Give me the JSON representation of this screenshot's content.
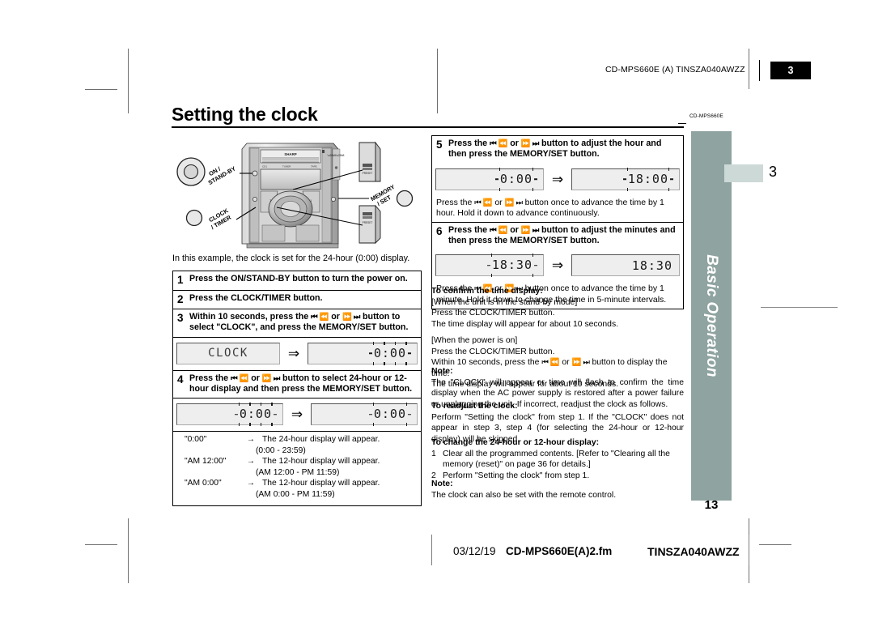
{
  "header": {
    "code": "CD-MPS660E (A) TINSZA040AWZZ",
    "page_badge": "3"
  },
  "title": "Setting the clock",
  "model_tag": "CD-MPS660E",
  "sidebar": {
    "label": "Basic Operation",
    "page_number": "13",
    "chapter_number": "3"
  },
  "footer": {
    "date": "03/12/19",
    "filename": "CD-MPS660E(A)2.fm",
    "code": "TINSZA040AWZZ"
  },
  "illustration": {
    "labels": {
      "on_standby": "ON /\nSTAND-BY",
      "clock_timer": "CLOCK\n/ TIMER",
      "memory_set": "MEMORY\n/ SET"
    },
    "brand": "SHARP"
  },
  "left": {
    "lead": "In this example, the clock is set for the 24-hour (0:00) display.",
    "steps": [
      {
        "num": "1",
        "text": "Press the ON/STAND-BY button to turn the power on."
      },
      {
        "num": "2",
        "text": "Press the CLOCK/TIMER button."
      },
      {
        "num": "3",
        "text_before": "Within 10 seconds, press the ",
        "glyph_a": "⏮ ⏪",
        "text_mid": " or ",
        "glyph_b": "⏩ ⏭",
        "text_after": " button to select \"CLOCK\", and press the MEMORY/SET button."
      },
      {
        "num": "4",
        "text_before": "Press the ",
        "glyph_a": "⏮ ⏪",
        "text_mid": " or ",
        "glyph_b": "⏩ ⏭",
        "text_after": " button to select 24-hour or 12-hour display and then press the MEMORY/SET button."
      }
    ],
    "display_step3": {
      "left_value": "CLOCK",
      "arrow": "⇒",
      "right_value": "0:00",
      "right_flashing": true
    },
    "display_step4": {
      "left_value": "0:00",
      "left_flashing": true,
      "arrow": "⇒",
      "right_value": "0:00",
      "right_flashing_digit": "0"
    },
    "formats": [
      {
        "value": "\"0:00\"",
        "arrow": "→",
        "result": "The 24-hour display will appear.",
        "range": "(0:00 - 23:59)"
      },
      {
        "value": "\"AM 12:00\"",
        "arrow": "→",
        "result": "The 12-hour display will appear.",
        "range": "(AM 12:00 - PM 11:59)"
      },
      {
        "value": "\"AM 0:00\"",
        "arrow": "→",
        "result": "The 12-hour display will appear.",
        "range": "(AM 0:00 - PM 11:59)"
      }
    ]
  },
  "right": {
    "steps": [
      {
        "num": "5",
        "text_before": "Press the ",
        "glyph_a": "⏮ ⏪",
        "text_mid": " or ",
        "glyph_b": "⏩ ⏭",
        "text_after": " button to adjust the hour and then press the MEMORY/SET button.",
        "display": {
          "left_value": "0:00",
          "arrow": "⇒",
          "right_value": "18:00"
        },
        "note_before": "Press the ",
        "note_mid": " or ",
        "note_after": " button once to advance the time by 1 hour. Hold it down to advance continuously."
      },
      {
        "num": "6",
        "text_before": "Press the ",
        "glyph_a": "⏮ ⏪",
        "text_mid": " or ",
        "glyph_b": "⏩ ⏭",
        "text_after": " button to adjust the minutes and then press the MEMORY/SET button.",
        "display": {
          "left_value": "18:30",
          "arrow": "⇒",
          "right_value": "18:30"
        },
        "note_after": " button once to advance the time by 1 minute. Hold it down to change the time in 5-minute intervals."
      }
    ],
    "confirm": {
      "heading": "To confirm the time display:",
      "line1": "[When the unit is in the stand-by mode]",
      "line2": "Press the CLOCK/TIMER button.",
      "line3": "The time display will appear for about 10 seconds.",
      "line4": "[When the power is on]",
      "line5": "Press the CLOCK/TIMER button.",
      "line6_before": "Within 10 seconds, press the ",
      "line6_mid": " or ",
      "line6_after": " button to display the time.",
      "line7": "The time display will appear for about 10 seconds."
    },
    "note1": {
      "heading": "Note:",
      "body": "The \"CLOCK\" will appear or time will flash to confirm the time display when the AC power supply is restored after a power failure or unplugging the unit. If incorrect, readjust the clock as follows."
    },
    "readjust": {
      "heading": "To readjust the clock:",
      "body": "Perform \"Setting the clock\" from step 1. If the \"CLOCK\" does not appear in step 3, step 4 (for selecting the 24-hour or 12-hour display) will be skipped."
    },
    "change": {
      "heading": "To change the 24-hour or 12-hour display:",
      "item1_num": "1",
      "item1": "Clear all the programmed contents. [Refer to \"Clearing all the memory (reset)\" on page 36 for details.]",
      "item2_num": "2",
      "item2": "Perform \"Setting the clock\" from step 1."
    },
    "note2": {
      "heading": "Note:",
      "body": "The clock can also be set with the remote control."
    }
  }
}
